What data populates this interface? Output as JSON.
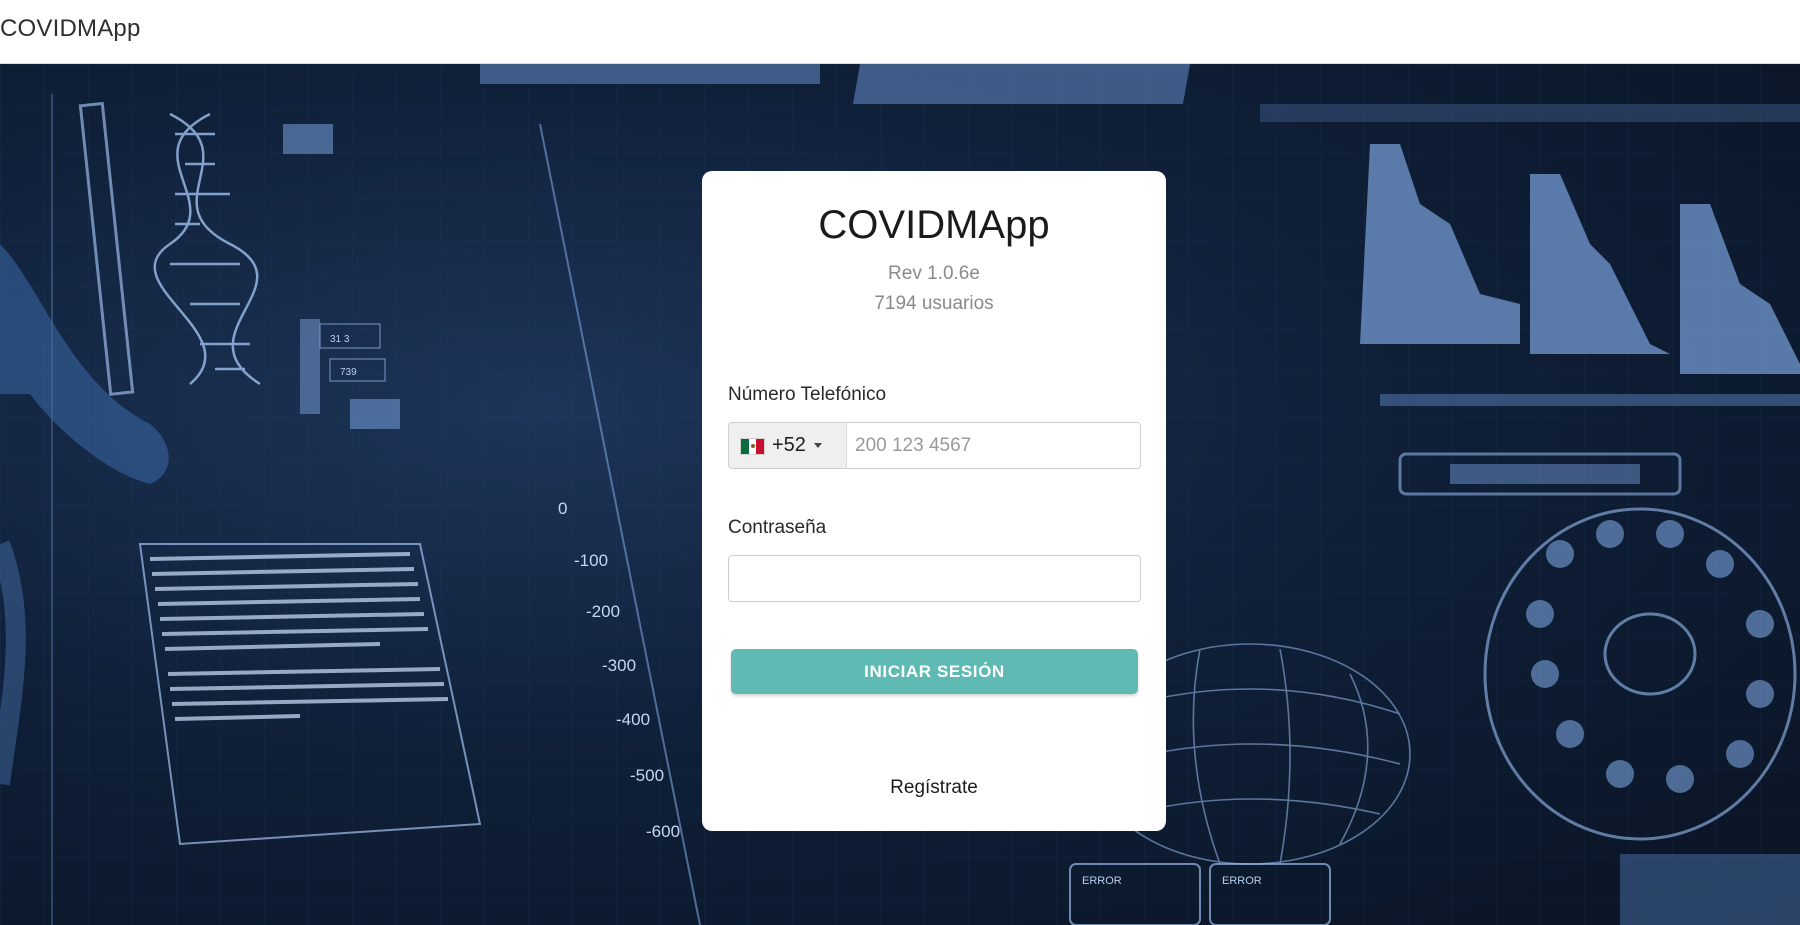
{
  "app": {
    "brand": "COVIDMApp"
  },
  "login": {
    "title": "COVIDMApp",
    "revision": "Rev 1.0.6e",
    "users": "7194 usuarios",
    "phone": {
      "label": "Número Telefónico",
      "country": "mx-flag-icon",
      "dial_code": "+52",
      "placeholder": "200 123 4567",
      "value": ""
    },
    "password": {
      "label": "Contraseña",
      "value": ""
    },
    "submit_label": "INICIAR SESIÓN",
    "register_label": "Regístrate"
  },
  "background": {
    "scale_labels": [
      "0",
      "-100",
      "-200",
      "-300",
      "-400",
      "-500",
      "-600"
    ],
    "panel_labels": [
      "ERROR",
      "ERROR"
    ],
    "chips": [
      "31 3",
      "739"
    ]
  },
  "colors": {
    "accent": "#5fbab4",
    "background": "#0f2039",
    "card": "#ffffff"
  }
}
